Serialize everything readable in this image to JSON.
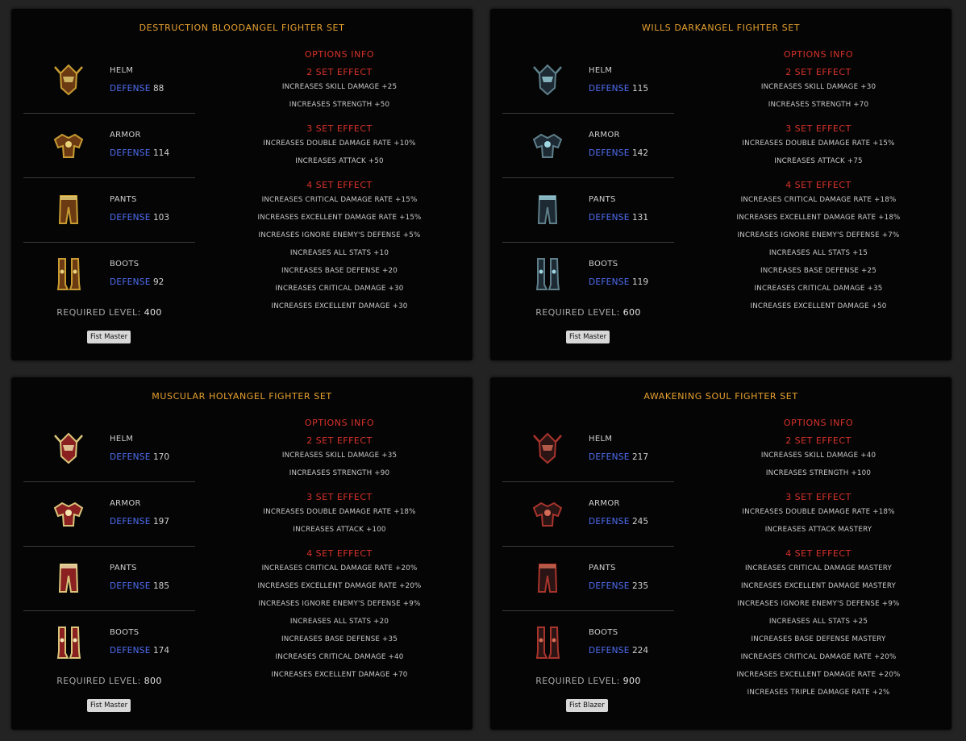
{
  "labels": {
    "defense": "DEFENSE",
    "required_level": "REQUIRED LEVEL:",
    "options_info": "OPTIONS INFO"
  },
  "colors": {
    "background": "#232323",
    "card": "#050505",
    "title": "#e7a12f",
    "set_effect": "#d8322a",
    "defense_label": "#4f6ef5"
  },
  "sets": [
    {
      "title": "DESTRUCTION BLOODANGEL FIGHTER SET",
      "items": [
        {
          "name": "HELM",
          "defense": "88",
          "icon": "helm-icon"
        },
        {
          "name": "ARMOR",
          "defense": "114",
          "icon": "armor-icon"
        },
        {
          "name": "PANTS",
          "defense": "103",
          "icon": "pants-icon"
        },
        {
          "name": "BOOTS",
          "defense": "92",
          "icon": "boots-icon"
        }
      ],
      "required_level": "400",
      "class_button": "Fist Master",
      "effects": [
        {
          "title": "2 SET EFFECT",
          "lines": [
            "INCREASES SKILL DAMAGE +25",
            "INCREASES STRENGTH +50"
          ]
        },
        {
          "title": "3 SET EFFECT",
          "lines": [
            "INCREASES DOUBLE DAMAGE RATE +10%",
            "INCREASES ATTACK +50"
          ]
        },
        {
          "title": "4 SET EFFECT",
          "lines": [
            "INCREASES CRITICAL DAMAGE RATE +15%",
            "INCREASES EXCELLENT DAMAGE RATE +15%",
            "INCREASES IGNORE ENEMY'S DEFENSE +5%",
            "INCREASES ALL STATS +10",
            "INCREASES BASE DEFENSE +20",
            "INCREASES CRITICAL DAMAGE +30",
            "INCREASES EXCELLENT DAMAGE +30"
          ]
        }
      ]
    },
    {
      "title": "WILLS DARKANGEL FIGHTER SET",
      "items": [
        {
          "name": "HELM",
          "defense": "115",
          "icon": "helm-icon"
        },
        {
          "name": "ARMOR",
          "defense": "142",
          "icon": "armor-icon"
        },
        {
          "name": "PANTS",
          "defense": "131",
          "icon": "pants-icon"
        },
        {
          "name": "BOOTS",
          "defense": "119",
          "icon": "boots-icon"
        }
      ],
      "required_level": "600",
      "class_button": "Fist Master",
      "effects": [
        {
          "title": "2 SET EFFECT",
          "lines": [
            "INCREASES SKILL DAMAGE +30",
            "INCREASES STRENGTH +70"
          ]
        },
        {
          "title": "3 SET EFFECT",
          "lines": [
            "INCREASES DOUBLE DAMAGE RATE +15%",
            "INCREASES ATTACK +75"
          ]
        },
        {
          "title": "4 SET EFFECT",
          "lines": [
            "INCREASES CRITICAL DAMAGE RATE +18%",
            "INCREASES EXCELLENT DAMAGE RATE +18%",
            "INCREASES IGNORE ENEMY'S DEFENSE +7%",
            "INCREASES ALL STATS +15",
            "INCREASES BASE DEFENSE +25",
            "INCREASES CRITICAL DAMAGE +35",
            "INCREASES EXCELLENT DAMAGE +50"
          ]
        }
      ]
    },
    {
      "title": "MUSCULAR HOLYANGEL FIGHTER SET",
      "items": [
        {
          "name": "HELM",
          "defense": "170",
          "icon": "helm-icon"
        },
        {
          "name": "ARMOR",
          "defense": "197",
          "icon": "armor-icon"
        },
        {
          "name": "PANTS",
          "defense": "185",
          "icon": "pants-icon"
        },
        {
          "name": "BOOTS",
          "defense": "174",
          "icon": "boots-icon"
        }
      ],
      "required_level": "800",
      "class_button": "Fist Master",
      "effects": [
        {
          "title": "2 SET EFFECT",
          "lines": [
            "INCREASES SKILL DAMAGE +35",
            "INCREASES STRENGTH +90"
          ]
        },
        {
          "title": "3 SET EFFECT",
          "lines": [
            "INCREASES DOUBLE DAMAGE RATE +18%",
            "INCREASES ATTACK +100"
          ]
        },
        {
          "title": "4 SET EFFECT",
          "lines": [
            "INCREASES CRITICAL DAMAGE RATE +20%",
            "INCREASES EXCELLENT DAMAGE RATE +20%",
            "INCREASES IGNORE ENEMY'S DEFENSE +9%",
            "INCREASES ALL STATS +20",
            "INCREASES BASE DEFENSE +35",
            "INCREASES CRITICAL DAMAGE +40",
            "INCREASES EXCELLENT DAMAGE +70"
          ]
        }
      ]
    },
    {
      "title": "AWAKENING SOUL FIGHTER SET",
      "items": [
        {
          "name": "HELM",
          "defense": "217",
          "icon": "helm-icon"
        },
        {
          "name": "ARMOR",
          "defense": "245",
          "icon": "armor-icon"
        },
        {
          "name": "PANTS",
          "defense": "235",
          "icon": "pants-icon"
        },
        {
          "name": "BOOTS",
          "defense": "224",
          "icon": "boots-icon"
        }
      ],
      "required_level": "900",
      "class_button": "Fist Blazer",
      "effects": [
        {
          "title": "2 SET EFFECT",
          "lines": [
            "INCREASES SKILL DAMAGE +40",
            "INCREASES STRENGTH +100"
          ]
        },
        {
          "title": "3 SET EFFECT",
          "lines": [
            "INCREASES DOUBLE DAMAGE RATE +18%",
            "INCREASES ATTACK MASTERY"
          ]
        },
        {
          "title": "4 SET EFFECT",
          "lines": [
            "INCREASES CRITICAL DAMAGE MASTERY",
            "INCREASES EXCELLENT DAMAGE MASTERY",
            "INCREASES IGNORE ENEMY'S DEFENSE +9%",
            "INCREASES ALL STATS +25",
            "INCREASES BASE DEFENSE MASTERY",
            "INCREASES CRITICAL DAMAGE RATE +20%",
            "INCREASES EXCELLENT DAMAGE RATE +20%",
            "INCREASES TRIPLE DAMAGE RATE +2%"
          ]
        }
      ]
    }
  ]
}
